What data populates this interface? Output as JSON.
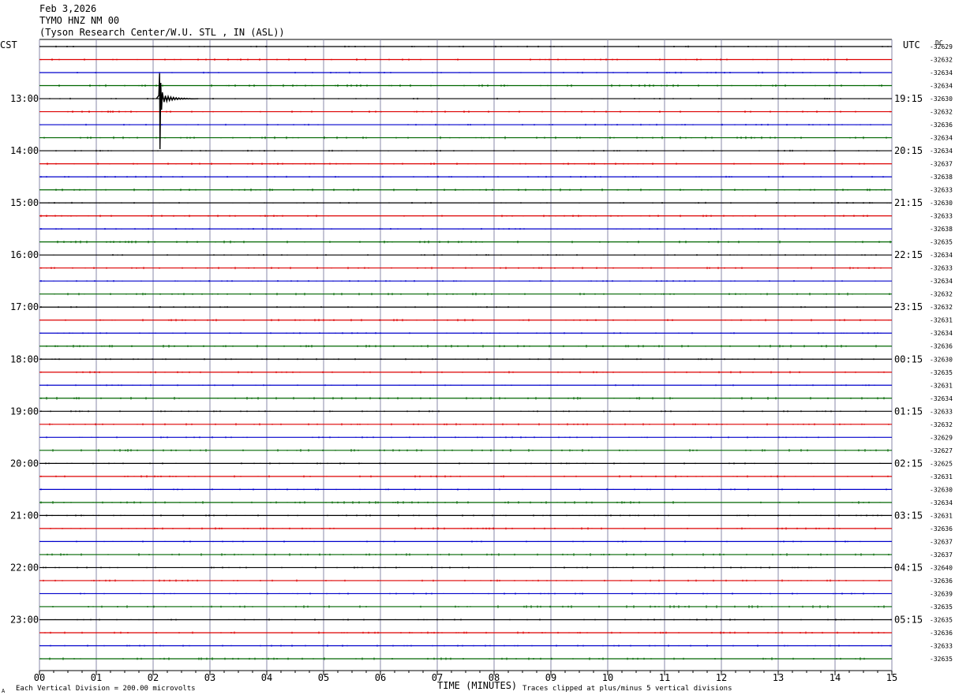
{
  "header": {
    "date": "Feb 3,2026",
    "station": "TYMO HNZ NM 00",
    "location": "(Tyson Research Center/W.U. STL , IN (ASL))"
  },
  "labels": {
    "left_tz": "CST",
    "right_tz": "UTC",
    "dc": "DC",
    "corner_mark": "A",
    "footer_left": "Each Vertical Division =  200.00 microvolts",
    "footer_right": "Traces clipped at plus/minus 5 vertical divisions"
  },
  "chart_data": {
    "type": "line",
    "title": "",
    "xlabel": "TIME (MINUTES)",
    "xlim": [
      0,
      15
    ],
    "x_ticks": [
      "00",
      "01",
      "02",
      "03",
      "04",
      "05",
      "06",
      "07",
      "08",
      "09",
      "10",
      "11",
      "12",
      "13",
      "14",
      "15"
    ],
    "trace_colors": [
      "#000000",
      "#dd0000",
      "#0000cc",
      "#006600"
    ],
    "left_hour_labels": [
      "13:00",
      "14:00",
      "15:00",
      "16:00",
      "17:00",
      "18:00",
      "19:00",
      "20:00",
      "21:00",
      "22:00",
      "23:00"
    ],
    "right_hour_labels": [
      "19:15",
      "20:15",
      "21:15",
      "22:15",
      "23:15",
      "00:15",
      "01:15",
      "02:15",
      "03:15",
      "04:15",
      "05:15"
    ],
    "dc_offsets": [
      "-32629",
      "-32632",
      "-32634",
      "-32634",
      "-32630",
      "-32632",
      "-32636",
      "-32634",
      "-32634",
      "-32637",
      "-32638",
      "-32633",
      "-32630",
      "-32633",
      "-32638",
      "-32635",
      "-32634",
      "-32633",
      "-32634",
      "-32632",
      "-32632",
      "-32631",
      "-32634",
      "-32636",
      "-32630",
      "-32635",
      "-32631",
      "-32634",
      "-32633",
      "-32632",
      "-32629",
      "-32627",
      "-32625",
      "-32631",
      "-32630",
      "-32634",
      "-32631",
      "-32636",
      "-32637",
      "-32637",
      "-32640",
      "-32636",
      "-32639",
      "-32635",
      "-32635",
      "-32636",
      "-32633",
      "-32635"
    ],
    "event": {
      "trace_index": 4,
      "minute": 2.1,
      "label": ""
    }
  }
}
